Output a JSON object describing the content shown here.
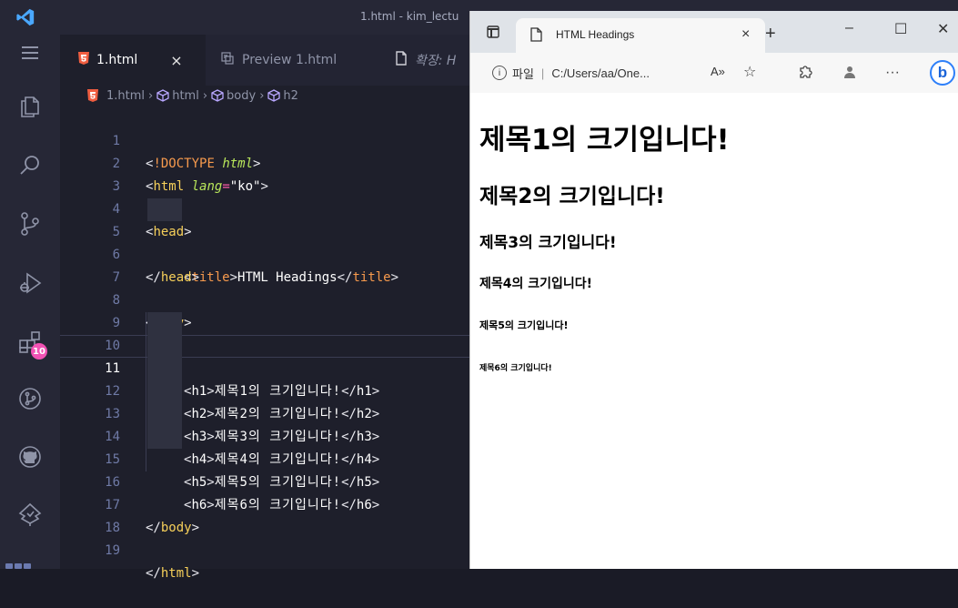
{
  "window_title": "1.html - kim_lectu",
  "tabs": [
    {
      "label": "1.html",
      "close": "×"
    },
    {
      "label": "Preview 1.html"
    },
    {
      "label": "확장: H"
    }
  ],
  "breadcrumb": [
    "1.html",
    "html",
    "body",
    "h2"
  ],
  "activity_bar": {
    "icons": [
      "explorer-icon",
      "search-icon",
      "source-control-icon",
      "run-debug-icon",
      "extensions-icon",
      "git-graph-icon",
      "github-icon",
      "tree-icon"
    ],
    "extensions_badge": "10"
  },
  "editor": {
    "current_line": "11",
    "line_numbers": [
      "1",
      "2",
      "3",
      "4",
      "5",
      "6",
      "7",
      "8",
      "9",
      "10",
      "11",
      "12",
      "13",
      "14",
      "15",
      "16",
      "17",
      "18",
      "19"
    ],
    "doctype_kw": "!DOCTYPE",
    "doctype_val": "html",
    "html_tag": "html",
    "lang_attr": "lang",
    "lang_val": "\"ko\"",
    "head_tag": "head",
    "title_tag": "title",
    "title_text": "HTML Headings",
    "body_tag": "body",
    "headings": [
      {
        "tag": "h1",
        "text": "제목1의 크기입니다!"
      },
      {
        "tag": "h2",
        "text": "제목2의 크기입니다!"
      },
      {
        "tag": "h3",
        "text": "제목3의 크기입니다!"
      },
      {
        "tag": "h4",
        "text": "제목4의 크기입니다!"
      },
      {
        "tag": "h5",
        "text": "제목5의 크기입니다!"
      },
      {
        "tag": "h6",
        "text": "제목6의 크기입니다!"
      }
    ]
  },
  "browser": {
    "tab_title": "HTML Headings",
    "tab_close": "×",
    "new_tab": "+",
    "controls": {
      "minimize": "–",
      "maximize": "☐",
      "close": "✕"
    },
    "address_scheme": "파일",
    "address_divider": "|",
    "address": "C:/Users/aa/One...",
    "read_aloud": "A»",
    "favorite": "☆",
    "more": "···",
    "bing": "b",
    "headings": [
      "제목1의 크기입니다!",
      "제목2의 크기입니다!",
      "제목3의 크기입니다!",
      "제목4의 크기입니다!",
      "제목5의 크기입니다!",
      "제목6의 크기입니다!"
    ]
  },
  "colors": {
    "accent_pink": "#f252b4",
    "tag_yellow": "#f7d05a",
    "attr_green": "#b8e65a",
    "bing_blue": "#2d7ff9"
  }
}
